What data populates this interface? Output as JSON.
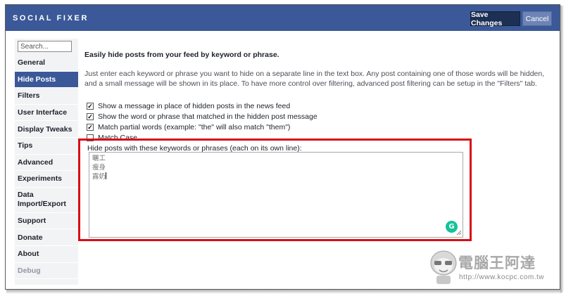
{
  "header": {
    "logo": "SOCIAL FIXER",
    "save_label": "Save Changes",
    "cancel_label": "Cancel"
  },
  "sidebar": {
    "search_placeholder": "Search...",
    "items": [
      {
        "label": "General",
        "active": false
      },
      {
        "label": "Hide Posts",
        "active": true
      },
      {
        "label": "Filters",
        "active": false
      },
      {
        "label": "User Interface",
        "active": false
      },
      {
        "label": "Display Tweaks",
        "active": false
      },
      {
        "label": "Tips",
        "active": false
      },
      {
        "label": "Advanced",
        "active": false
      },
      {
        "label": "Experiments",
        "active": false
      },
      {
        "label": "Data",
        "label2": "Import/Export",
        "active": false
      },
      {
        "label": "Support",
        "active": false
      },
      {
        "label": "Donate",
        "active": false
      },
      {
        "label": "About",
        "active": false
      },
      {
        "label": "Debug",
        "active": false,
        "disabled": true
      }
    ]
  },
  "main": {
    "heading": "Easily hide posts from your feed by keyword or phrase.",
    "description": "Just enter each keyword or phrase you want to hide on a separate line in the text box. Any post containing one of those words will be hidden, and a small message will be shown in its place. To have more control over filtering, advanced post filtering can be setup in the \"Filters\" tab.",
    "options": [
      {
        "label": "Show a message in place of hidden posts in the news feed",
        "checked": true
      },
      {
        "label": "Show the word or phrase that matched in the hidden post message",
        "checked": true
      },
      {
        "label": "Match partial words (example: \"the\" will also match \"them\")",
        "checked": true
      },
      {
        "label": "Match Case",
        "checked": false
      }
    ],
    "keywords_label": "Hide posts with these keywords or phrases (each on its own line):",
    "keywords": [
      "曬工",
      "瘦身",
      "露奶"
    ]
  },
  "watermark": {
    "text": "電腦王阿達",
    "url": "http://www.kocpc.com.tw"
  },
  "colors": {
    "brand": "#3b5998",
    "save_button": "#1d2f52",
    "highlight": "#d60e14",
    "grammarly": "#15c39a"
  }
}
